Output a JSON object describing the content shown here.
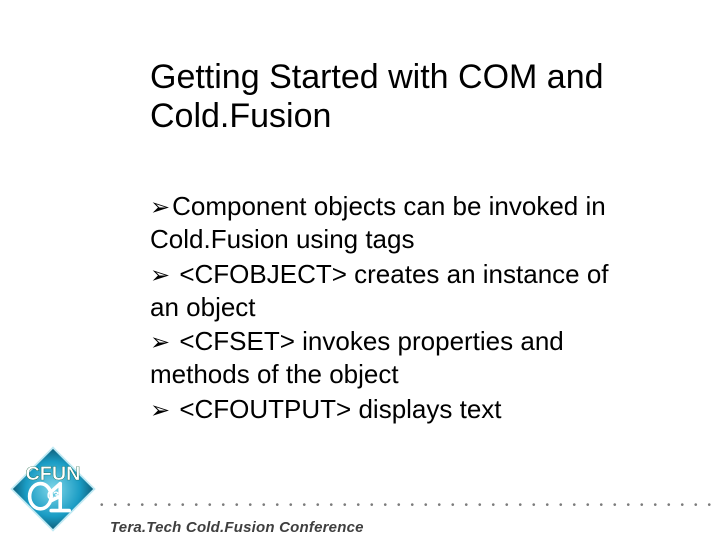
{
  "title": "Getting Started with COM and Cold.Fusion",
  "bullets": [
    "Component objects can be invoked in Cold.Fusion using tags",
    " <CFOBJECT> creates an instance of an object",
    " <CFSET>  invokes properties and methods of the object",
    " <CFOUTPUT> displays text"
  ],
  "footer": "Tera.Tech Cold.Fusion Conference"
}
